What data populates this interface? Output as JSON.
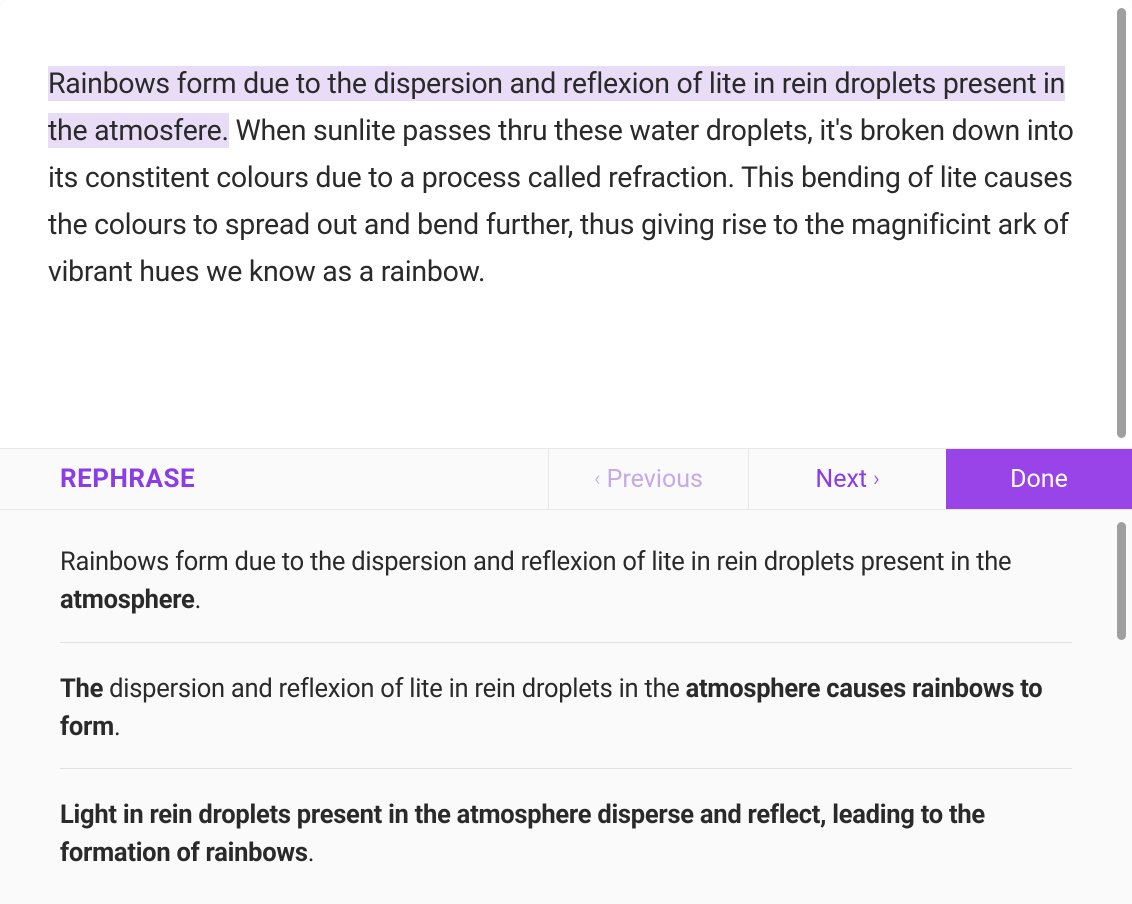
{
  "editor": {
    "highlighted": "Rainbows form due to the dispersion and reflexion of lite in rein droplets present in the atmosfere.",
    "rest": " When sunlite passes thru these water droplets, it's broken down into its constitent colours due to a process called refraction. This bending of lite causes the colours to spread out and bend further, thus giving rise to the magnificint ark of vibrant hues we know as a rainbow."
  },
  "toolbar": {
    "label": "REPHRASE",
    "prev": "Previous",
    "next": "Next",
    "done": "Done"
  },
  "suggestions": [
    {
      "segments": [
        {
          "text": "Rainbows form due to the dispersion and reflexion of lite in rein droplets present in the ",
          "bold": false
        },
        {
          "text": "atmosphere",
          "bold": true
        },
        {
          "text": ".",
          "bold": false
        }
      ]
    },
    {
      "segments": [
        {
          "text": "The",
          "bold": true
        },
        {
          "text": " dispersion and reflexion of lite in rein droplets in the ",
          "bold": false
        },
        {
          "text": "atmosphere causes rainbows to form",
          "bold": true
        },
        {
          "text": ".",
          "bold": false
        }
      ]
    },
    {
      "segments": [
        {
          "text": "Light in rein droplets present in the atmosphere disperse and reflect, leading to the formation of rainbows",
          "bold": true
        },
        {
          "text": ".",
          "bold": false
        }
      ]
    }
  ]
}
